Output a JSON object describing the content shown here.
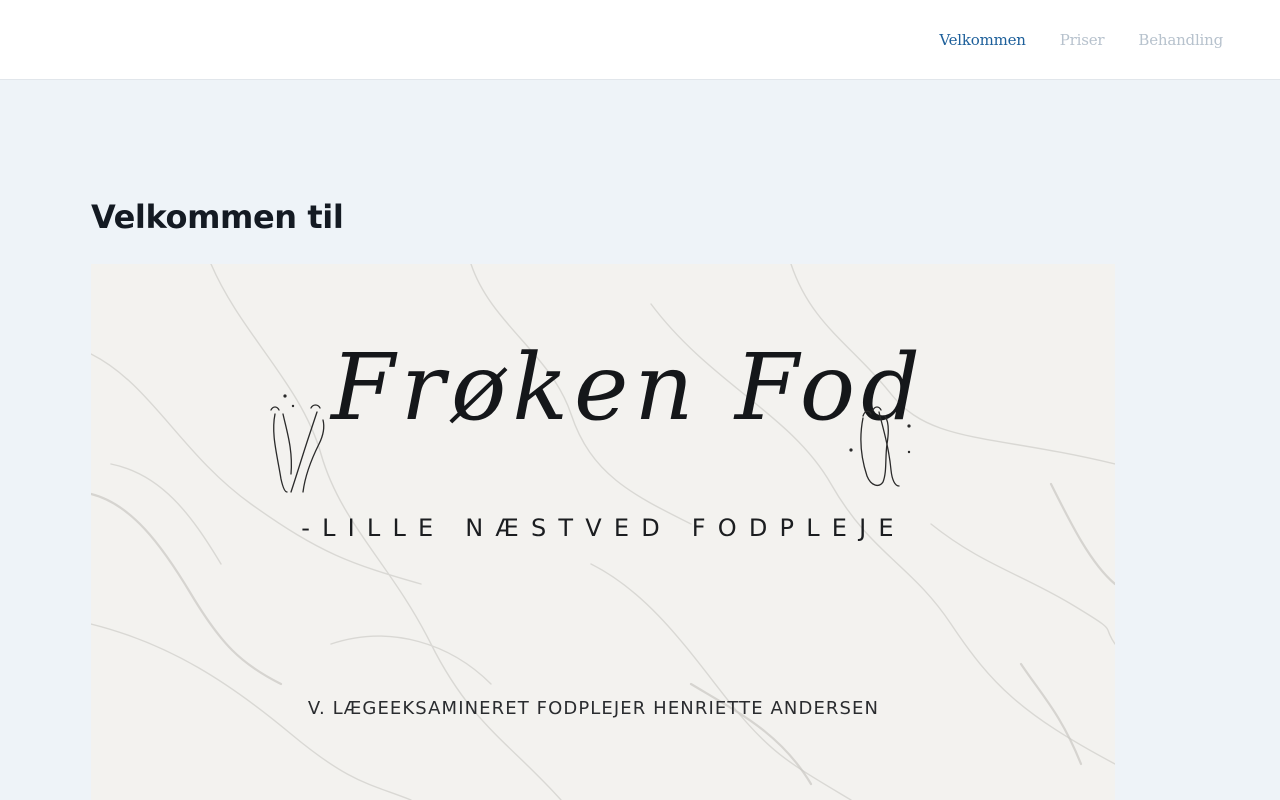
{
  "nav": {
    "items": [
      {
        "label": "Velkommen",
        "active": true
      },
      {
        "label": "Priser",
        "active": false
      },
      {
        "label": "Behandling",
        "active": false
      }
    ]
  },
  "main": {
    "title": "Velkommen til"
  },
  "hero": {
    "brand_name": "Frøken Fod",
    "subtitle": "-LILLE NÆSTVED FODPLEJE",
    "credit": "V. LÆGEEKSAMINERET FODPLEJER HENRIETTE ANDERSEN",
    "background": "marble",
    "icons": [
      "crossed-feet-icon",
      "foot-sole-icon"
    ]
  },
  "colors": {
    "page_bg": "#eef3f8",
    "nav_active": "#1d5f9a",
    "nav_inactive": "#b7c2cd",
    "title": "#141a23"
  }
}
